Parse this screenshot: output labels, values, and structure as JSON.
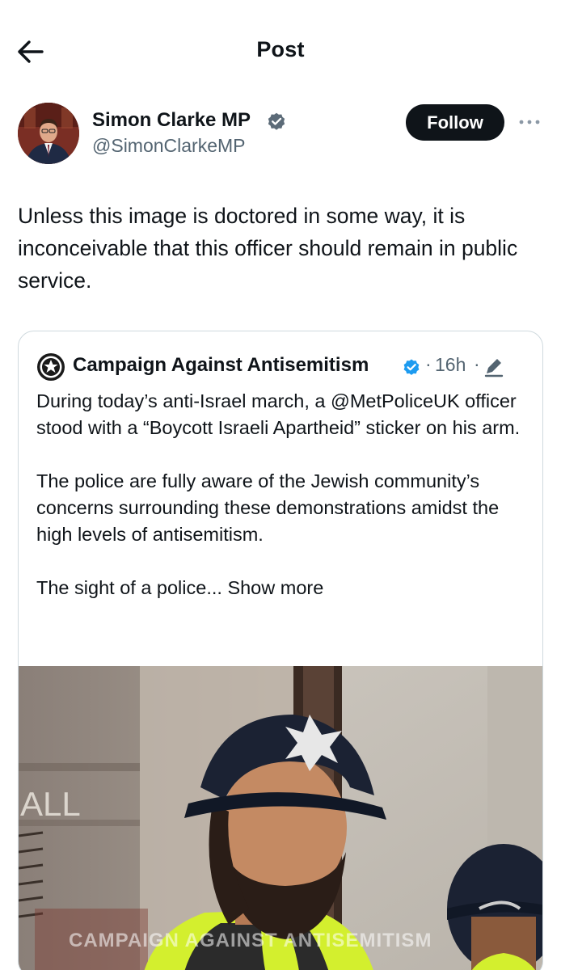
{
  "header": {
    "back_icon": "arrow-left-icon",
    "title": "Post"
  },
  "author": {
    "name": "Simon Clarke MP",
    "handle": "@SimonClarkeMP",
    "verified_icon": "verified-badge-icon",
    "follow_label": "Follow",
    "more_icon": "more-dots-icon"
  },
  "post": {
    "text": "Unless this image is doctored in some way, it is inconceivable that this officer should remain in public service."
  },
  "quote": {
    "name": "Campaign Against Antisemitism",
    "verified_icon": "verified-badge-icon",
    "dot": "·",
    "time": "16h",
    "edit_icon": "edit-pencil-icon",
    "paragraph1": "During today’s anti-Israel march, a @MetPoliceUK officer stood with a “Boycott Israeli Apartheid” sticker on his arm.",
    "paragraph2": "The police are fully aware of the Jewish community’s concerns surrounding these demonstrations amidst the high levels of antisemitism.",
    "paragraph3_prefix": "The sight of a police...",
    "show_more": "Show more",
    "media": {
      "watermark": "CAMPAIGN AGAINST ANTISEMITISM",
      "sign_text": "ALL",
      "description_icon": "photo-police-officers"
    }
  },
  "colors": {
    "text": "#0f1419",
    "secondary": "#536471",
    "verified": "#1d9bf0",
    "border": "#cfd9de",
    "follow_bg": "#0f1419"
  }
}
